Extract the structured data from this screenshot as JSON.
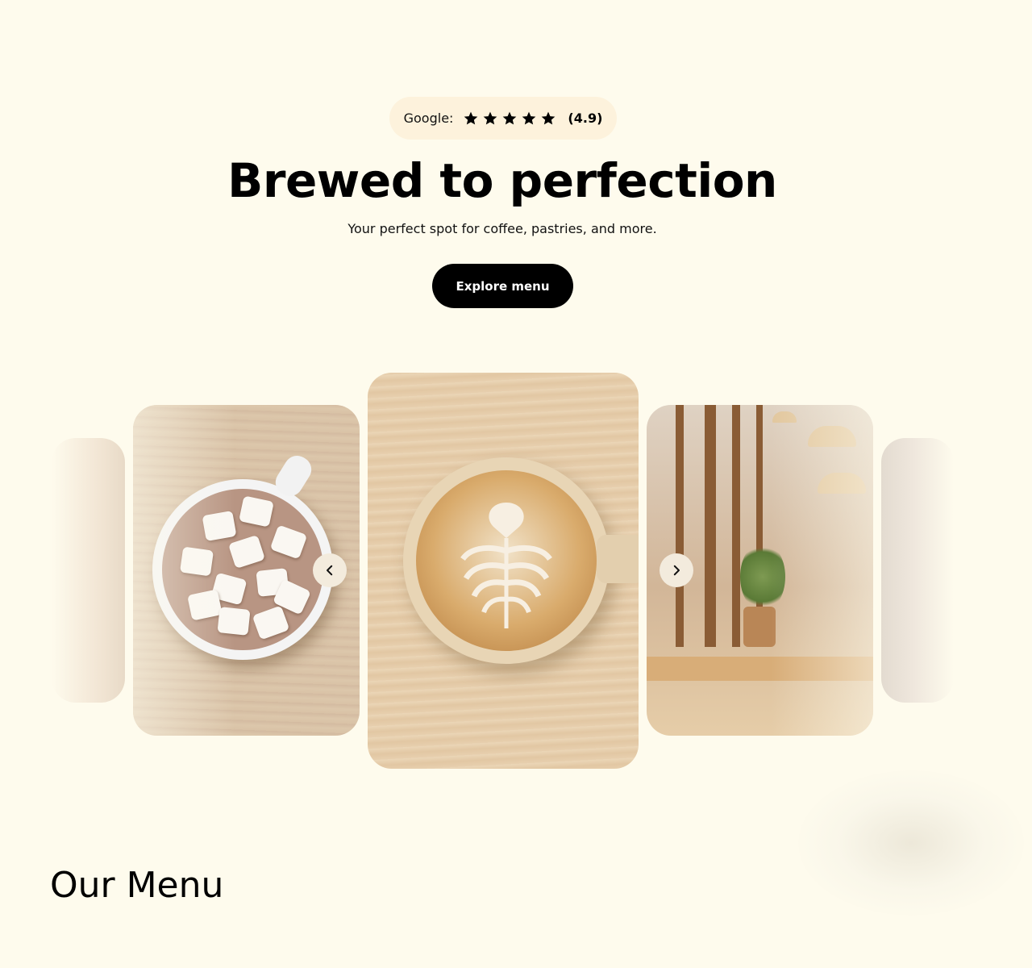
{
  "rating": {
    "label": "Google:",
    "stars": 5,
    "score": "(4.9)"
  },
  "hero": {
    "title": "Brewed to perfection",
    "subtitle": "Your perfect spot for coffee, pastries, and more.",
    "cta_label": "Explore menu"
  },
  "carousel": {
    "slides": [
      "pastry-photo",
      "hot-chocolate-photo",
      "latte-art-photo",
      "cafe-interior-photo",
      "cafe-counter-photo"
    ],
    "active_slide": "latte-art-photo",
    "prev_icon": "chevron-left-icon",
    "next_icon": "chevron-right-icon"
  },
  "menu_section": {
    "title": "Our Menu"
  },
  "colors": {
    "background": "#fefbed",
    "pill": "#fdf2dc",
    "button": "#000000"
  }
}
